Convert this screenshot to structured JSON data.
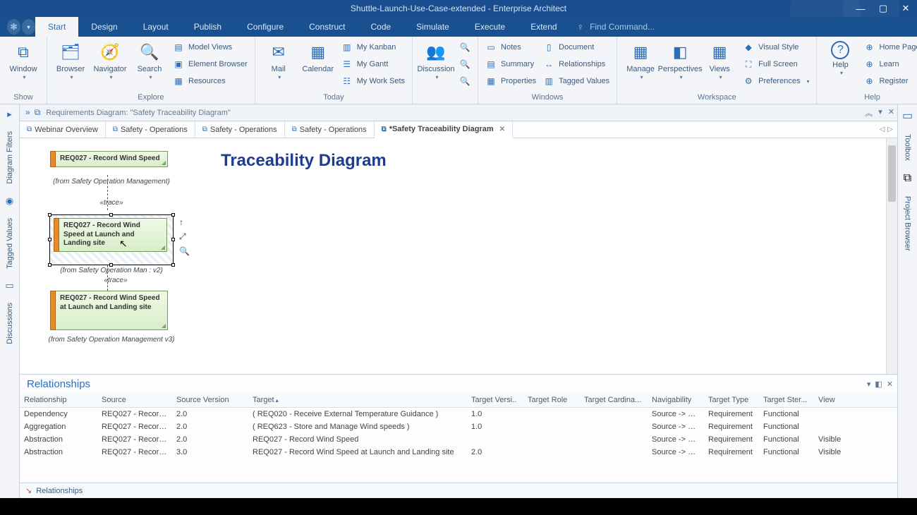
{
  "titlebar": {
    "title": "Shuttle-Launch-Use-Case-extended - Enterprise Architect"
  },
  "tabs": [
    "Start",
    "Design",
    "Layout",
    "Publish",
    "Configure",
    "Construct",
    "Code",
    "Simulate",
    "Execute",
    "Extend"
  ],
  "active_tab": "Start",
  "find_placeholder": "Find Command...",
  "ribbon": {
    "show": {
      "window": "Window",
      "label": "Show"
    },
    "explore": {
      "browser": "Browser",
      "navigator": "Navigator",
      "search": "Search",
      "model_views": "Model Views",
      "element_browser": "Element Browser",
      "resources": "Resources",
      "label": "Explore"
    },
    "today": {
      "mail": "Mail",
      "calendar": "Calendar",
      "kanban": "My Kanban",
      "gantt": "My Gantt",
      "worksets": "My Work Sets",
      "label": "Today"
    },
    "collab": {
      "discussion": "Discussion"
    },
    "windows": {
      "notes": "Notes",
      "summary": "Summary",
      "properties": "Properties",
      "document": "Document",
      "relationships": "Relationships",
      "tagged": "Tagged Values",
      "label": "Windows"
    },
    "workspace": {
      "manage": "Manage",
      "perspectives": "Perspectives",
      "views": "Views",
      "visual": "Visual Style",
      "fullscreen": "Full Screen",
      "prefs": "Preferences",
      "label": "Workspace"
    },
    "help": {
      "help": "Help",
      "home": "Home Page",
      "learn": "Learn",
      "register": "Register",
      "label": "Help"
    }
  },
  "breadcrumb": "Requirements Diagram: \"Safety Traceability Diagram\"",
  "doc_tabs": [
    {
      "label": "Webinar Overview",
      "active": false,
      "dirty": false
    },
    {
      "label": "Safety - Operations",
      "active": false,
      "dirty": false
    },
    {
      "label": "Safety - Operations",
      "active": false,
      "dirty": false
    },
    {
      "label": "Safety - Operations",
      "active": false,
      "dirty": false
    },
    {
      "label": "*Safety Traceability Diagram",
      "active": true,
      "dirty": true
    }
  ],
  "leftrail": [
    "Diagram Filters",
    "Tagged Values",
    "Discussions"
  ],
  "rightrail": [
    "Toolbox",
    "Project Browser"
  ],
  "diagram": {
    "title": "Traceability Diagram",
    "req1": {
      "text": "REQ027 - Record Wind Speed",
      "from": "(from Safety Operation Management)"
    },
    "trace1": "«trace»",
    "req2": {
      "text": "REQ027 - Record Wind Speed at Launch and Landing site",
      "from": "(from Safety Operation Man            : v2)"
    },
    "trace2": "«trace»",
    "req3": {
      "text": "REQ027 - Record Wind Speed at Launch and Landing site",
      "from": "(from Safety Operation Management v3)"
    }
  },
  "rel_panel": {
    "title": "Relationships",
    "columns": [
      "Relationship",
      "Source",
      "Source Version",
      "Target",
      "Target Versi..",
      "Target Role",
      "Target Cardina...",
      "Navigability",
      "Target Type",
      "Target Ster...",
      "View"
    ],
    "sort_col": 3,
    "rows": [
      [
        "Dependency",
        "REQ027 - Record ...",
        "2.0",
        "( REQ020 - Receive External Temperature Guidance )",
        "1.0",
        "",
        "",
        "Source -> D...",
        "Requirement",
        "Functional",
        ""
      ],
      [
        "Aggregation",
        "REQ027 - Record ...",
        "2.0",
        "( REQ623 - Store and Manage Wind speeds )",
        "1.0",
        "",
        "",
        "Source -> D...",
        "Requirement",
        "Functional",
        ""
      ],
      [
        "Abstraction",
        "REQ027 - Record ...",
        "2.0",
        "REQ027 - Record Wind Speed",
        "",
        "",
        "",
        "Source -> D...",
        "Requirement",
        "Functional",
        "Visible"
      ],
      [
        "Abstraction",
        "REQ027 - Record ...",
        "3.0",
        "REQ027 - Record Wind Speed at Launch and Landing site",
        "2.0",
        "",
        "",
        "Source -> D...",
        "Requirement",
        "Functional",
        "Visible"
      ]
    ],
    "footer": "Relationships"
  }
}
